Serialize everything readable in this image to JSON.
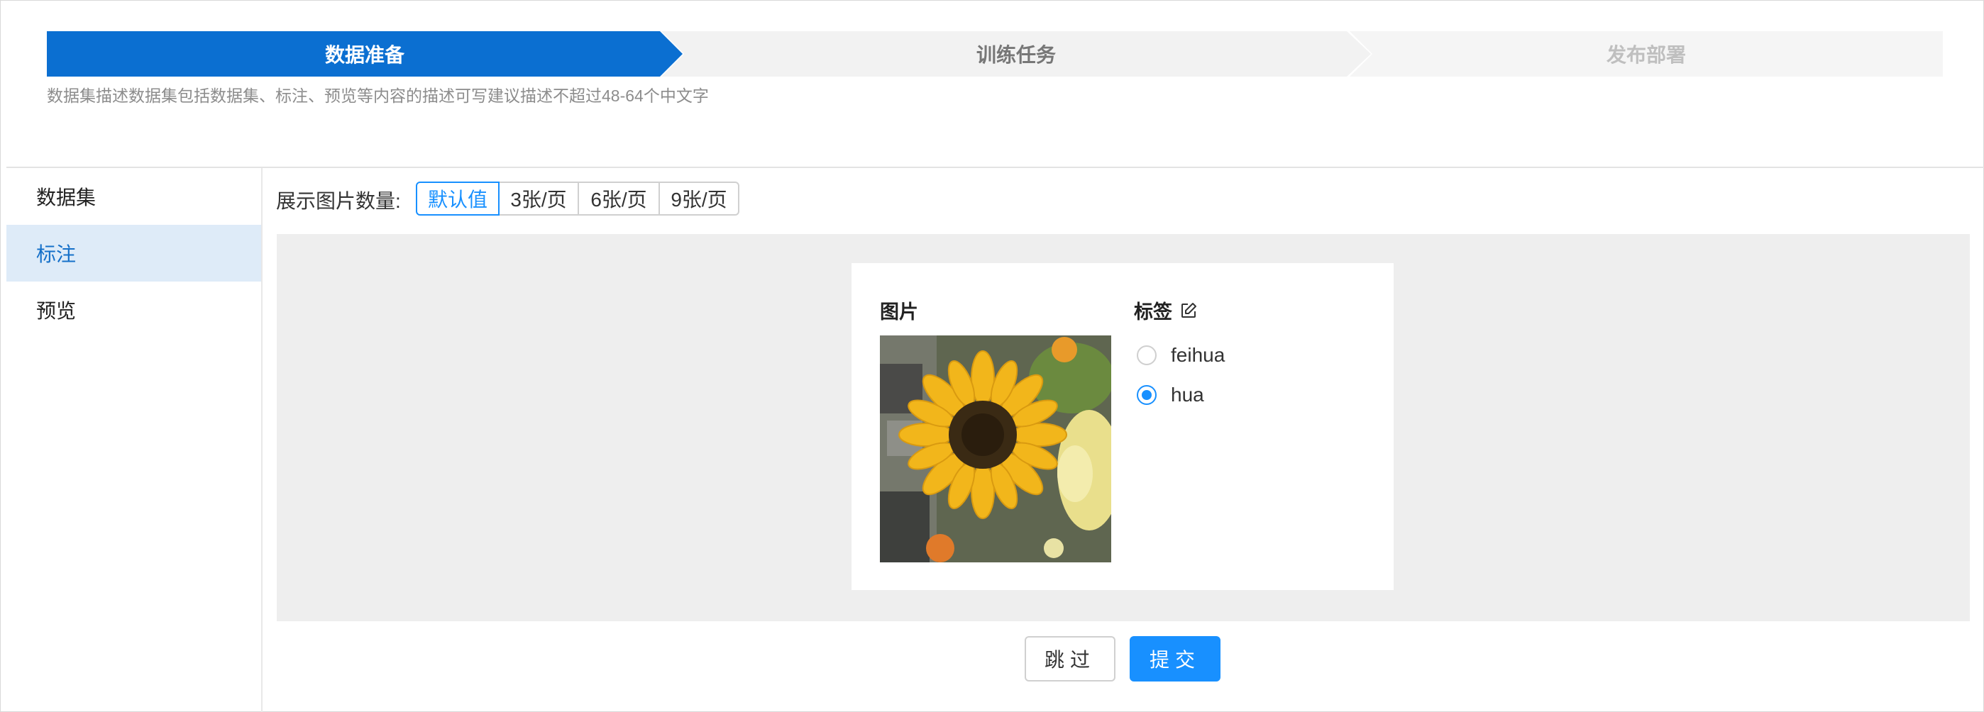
{
  "steps": [
    {
      "label": "数据准备",
      "state": "active"
    },
    {
      "label": "训练任务",
      "state": "pending"
    },
    {
      "label": "发布部署",
      "state": "disabled"
    }
  ],
  "step_description": "数据集描述数据集包括数据集、标注、预览等内容的描述可写建议描述不超过48-64个中文字",
  "sidebar": {
    "items": [
      {
        "label": "数据集",
        "active": false
      },
      {
        "label": "标注",
        "active": true
      },
      {
        "label": "预览",
        "active": false
      }
    ]
  },
  "toolbar": {
    "count_label": "展示图片数量:",
    "options": [
      "默认值",
      "3张/页",
      "6张/页",
      "9张/页"
    ],
    "selected": "默认值"
  },
  "card": {
    "image_header": "图片",
    "label_header": "标签",
    "label_edit_icon": "edit-icon",
    "image_subject": "sunflower",
    "labels": [
      {
        "name": "feihua",
        "checked": false
      },
      {
        "name": "hua",
        "checked": true
      }
    ]
  },
  "actions": {
    "skip": "跳过",
    "submit": "提交"
  },
  "colors": {
    "primary": "#1890ff",
    "step_active": "#0b6fd1",
    "sidebar_active_bg": "#deebf8",
    "canvas_bg": "#eeeeee"
  }
}
